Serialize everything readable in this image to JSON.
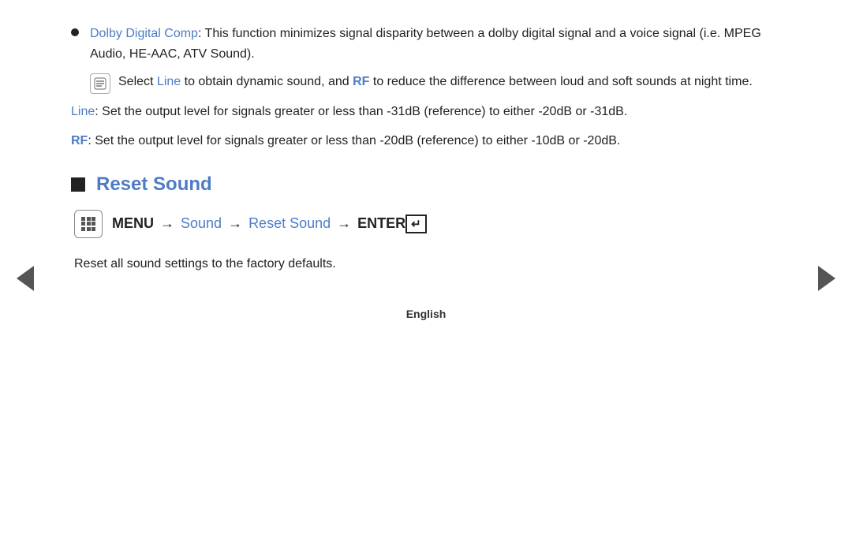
{
  "nav": {
    "left_arrow": "◀",
    "right_arrow": "▶"
  },
  "bullet": {
    "term": "Dolby Digital Comp",
    "description": ": This function minimizes signal disparity between a dolby digital signal and a voice signal (i.e. MPEG Audio, HE-AAC, ATV Sound).",
    "note_select": "Select ",
    "note_line": "Line",
    "note_middle": " to obtain dynamic sound, and ",
    "note_rf": "RF",
    "note_end": " to reduce the difference between loud and soft sounds at night time."
  },
  "line_info": {
    "label": "Line",
    "text": ": Set the output level for signals greater or less than -31dB (reference) to either -20dB or -31dB."
  },
  "rf_info": {
    "label": "RF",
    "text": ": Set the output level for signals greater or less than -20dB (reference) to either -10dB or -20dB."
  },
  "section": {
    "title": "Reset Sound"
  },
  "menu_path": {
    "menu_label": "MENU",
    "arrow1": "→",
    "sound": "Sound",
    "arrow2": "→",
    "reset_sound": "Reset Sound",
    "arrow3": "→",
    "enter_label": "ENTER"
  },
  "description": "Reset all sound settings to the factory defaults.",
  "footer": {
    "language": "English"
  }
}
